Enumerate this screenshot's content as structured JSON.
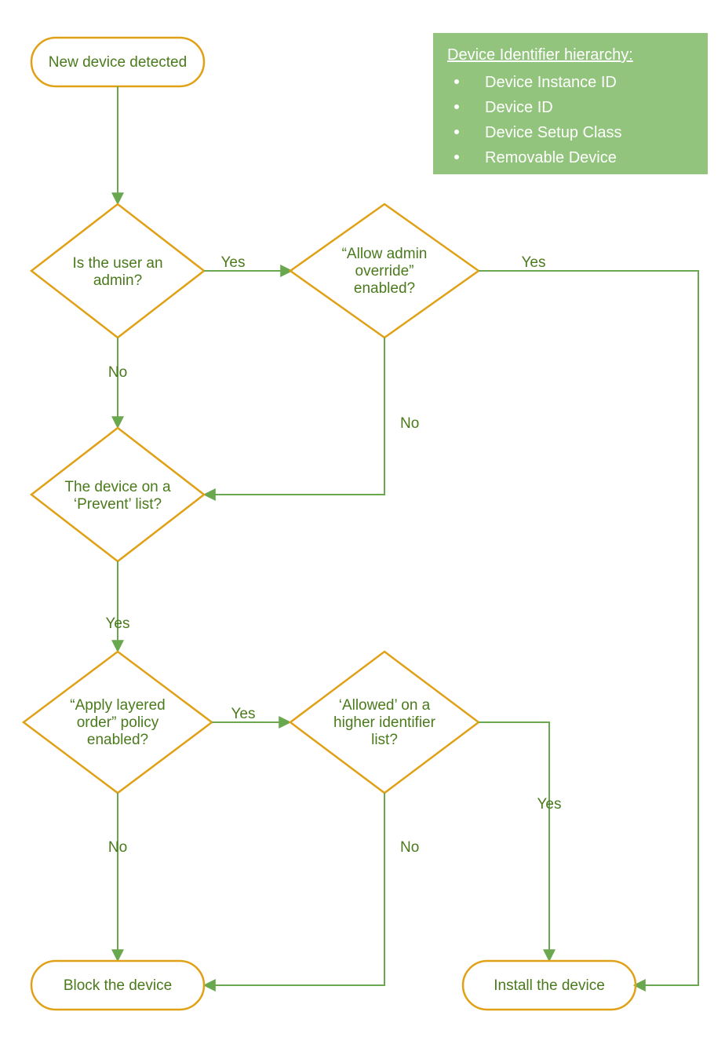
{
  "colors": {
    "stroke": "#e0a116",
    "flow": "#6aa84f",
    "legend_bg": "#93c47d",
    "text": "#4a7a1c"
  },
  "legend": {
    "title": "Device Identifier hierarchy:",
    "items": [
      "Device Instance ID",
      "Device ID",
      "Device Setup Class",
      "Removable Device"
    ]
  },
  "nodes": {
    "start": {
      "line1": "New device detected"
    },
    "admin": {
      "line1": "Is the user an",
      "line2": "admin?"
    },
    "override": {
      "line1": "“Allow admin",
      "line2": "override”",
      "line3": "enabled?"
    },
    "prevent": {
      "line1": "The device on a",
      "line2": "‘Prevent’ list?"
    },
    "layered": {
      "line1": "“Apply layered",
      "line2": "order” policy",
      "line3": "enabled?"
    },
    "higher": {
      "line1": "‘Allowed’ on a",
      "line2": "higher identifier",
      "line3": "list?"
    },
    "block": {
      "line1": "Block the device"
    },
    "install": {
      "line1": "Install the device"
    }
  },
  "labels": {
    "yes": "Yes",
    "no": "No"
  }
}
